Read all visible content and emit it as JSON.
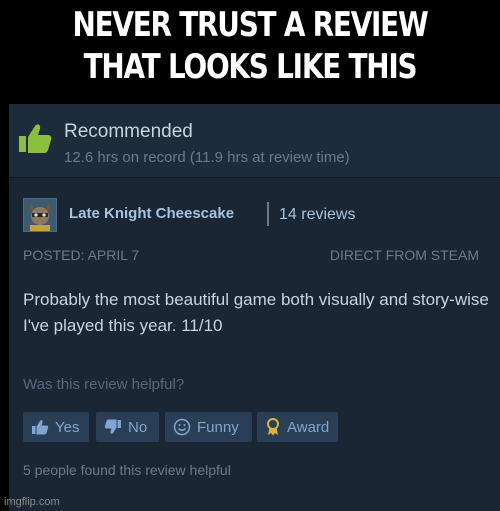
{
  "caption": {
    "line1": "NEVER TRUST A REVIEW",
    "line2": "THAT LOOKS LIKE THIS"
  },
  "review": {
    "verdict": "Recommended",
    "hours": "12.6 hrs on record (11.9 hrs at review time)",
    "author": "Late Knight Cheescake",
    "review_count": "14 reviews",
    "posted": "POSTED: APRIL 7",
    "source": "DIRECT FROM STEAM",
    "text": "Probably the most beautiful game both visually and story-wise I've played this year. 11/10",
    "question": "Was this review helpful?",
    "buttons": {
      "yes": "Yes",
      "no": "No",
      "funny": "Funny",
      "award": "Award"
    },
    "helpful_count": "5 people found this review helpful"
  },
  "watermark": "imgflip.com",
  "colors": {
    "card_bg": "#1a2634",
    "header_bg": "#1e2b3b",
    "thumb_green": "#8bbf3c",
    "button_bg": "#2a3f55",
    "button_text": "#7fa6d0",
    "award_gold": "#d9b53b"
  },
  "icons": {
    "verdict": "thumbs-up-icon",
    "yes": "thumbs-up-icon",
    "no": "thumbs-down-icon",
    "funny": "smiley-icon",
    "award": "award-ribbon-icon"
  }
}
